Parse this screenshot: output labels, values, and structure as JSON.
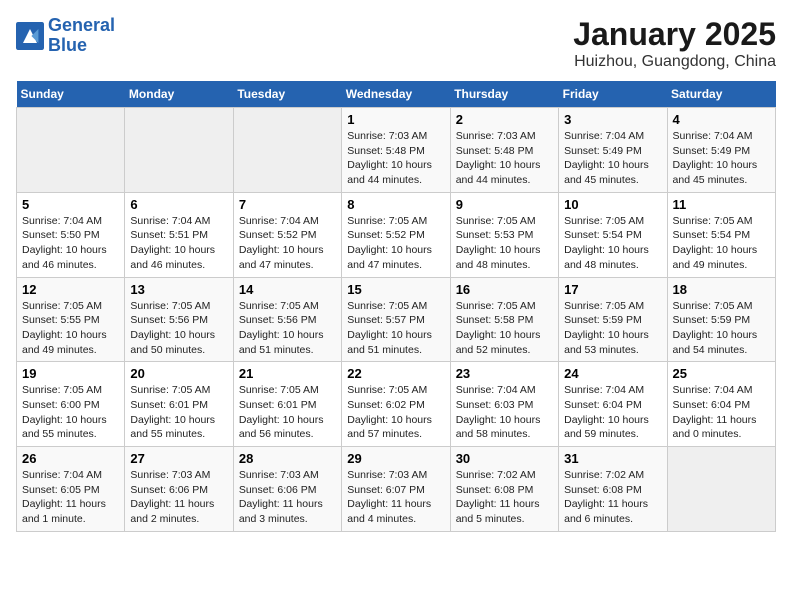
{
  "logo": {
    "line1": "General",
    "line2": "Blue"
  },
  "title": "January 2025",
  "subtitle": "Huizhou, Guangdong, China",
  "weekdays": [
    "Sunday",
    "Monday",
    "Tuesday",
    "Wednesday",
    "Thursday",
    "Friday",
    "Saturday"
  ],
  "weeks": [
    [
      {
        "day": "",
        "sunrise": "",
        "sunset": "",
        "daylight": "",
        "empty": true
      },
      {
        "day": "",
        "sunrise": "",
        "sunset": "",
        "daylight": "",
        "empty": true
      },
      {
        "day": "",
        "sunrise": "",
        "sunset": "",
        "daylight": "",
        "empty": true
      },
      {
        "day": "1",
        "sunrise": "Sunrise: 7:03 AM",
        "sunset": "Sunset: 5:48 PM",
        "daylight": "Daylight: 10 hours and 44 minutes."
      },
      {
        "day": "2",
        "sunrise": "Sunrise: 7:03 AM",
        "sunset": "Sunset: 5:48 PM",
        "daylight": "Daylight: 10 hours and 44 minutes."
      },
      {
        "day": "3",
        "sunrise": "Sunrise: 7:04 AM",
        "sunset": "Sunset: 5:49 PM",
        "daylight": "Daylight: 10 hours and 45 minutes."
      },
      {
        "day": "4",
        "sunrise": "Sunrise: 7:04 AM",
        "sunset": "Sunset: 5:49 PM",
        "daylight": "Daylight: 10 hours and 45 minutes."
      }
    ],
    [
      {
        "day": "5",
        "sunrise": "Sunrise: 7:04 AM",
        "sunset": "Sunset: 5:50 PM",
        "daylight": "Daylight: 10 hours and 46 minutes."
      },
      {
        "day": "6",
        "sunrise": "Sunrise: 7:04 AM",
        "sunset": "Sunset: 5:51 PM",
        "daylight": "Daylight: 10 hours and 46 minutes."
      },
      {
        "day": "7",
        "sunrise": "Sunrise: 7:04 AM",
        "sunset": "Sunset: 5:52 PM",
        "daylight": "Daylight: 10 hours and 47 minutes."
      },
      {
        "day": "8",
        "sunrise": "Sunrise: 7:05 AM",
        "sunset": "Sunset: 5:52 PM",
        "daylight": "Daylight: 10 hours and 47 minutes."
      },
      {
        "day": "9",
        "sunrise": "Sunrise: 7:05 AM",
        "sunset": "Sunset: 5:53 PM",
        "daylight": "Daylight: 10 hours and 48 minutes."
      },
      {
        "day": "10",
        "sunrise": "Sunrise: 7:05 AM",
        "sunset": "Sunset: 5:54 PM",
        "daylight": "Daylight: 10 hours and 48 minutes."
      },
      {
        "day": "11",
        "sunrise": "Sunrise: 7:05 AM",
        "sunset": "Sunset: 5:54 PM",
        "daylight": "Daylight: 10 hours and 49 minutes."
      }
    ],
    [
      {
        "day": "12",
        "sunrise": "Sunrise: 7:05 AM",
        "sunset": "Sunset: 5:55 PM",
        "daylight": "Daylight: 10 hours and 49 minutes."
      },
      {
        "day": "13",
        "sunrise": "Sunrise: 7:05 AM",
        "sunset": "Sunset: 5:56 PM",
        "daylight": "Daylight: 10 hours and 50 minutes."
      },
      {
        "day": "14",
        "sunrise": "Sunrise: 7:05 AM",
        "sunset": "Sunset: 5:56 PM",
        "daylight": "Daylight: 10 hours and 51 minutes."
      },
      {
        "day": "15",
        "sunrise": "Sunrise: 7:05 AM",
        "sunset": "Sunset: 5:57 PM",
        "daylight": "Daylight: 10 hours and 51 minutes."
      },
      {
        "day": "16",
        "sunrise": "Sunrise: 7:05 AM",
        "sunset": "Sunset: 5:58 PM",
        "daylight": "Daylight: 10 hours and 52 minutes."
      },
      {
        "day": "17",
        "sunrise": "Sunrise: 7:05 AM",
        "sunset": "Sunset: 5:59 PM",
        "daylight": "Daylight: 10 hours and 53 minutes."
      },
      {
        "day": "18",
        "sunrise": "Sunrise: 7:05 AM",
        "sunset": "Sunset: 5:59 PM",
        "daylight": "Daylight: 10 hours and 54 minutes."
      }
    ],
    [
      {
        "day": "19",
        "sunrise": "Sunrise: 7:05 AM",
        "sunset": "Sunset: 6:00 PM",
        "daylight": "Daylight: 10 hours and 55 minutes."
      },
      {
        "day": "20",
        "sunrise": "Sunrise: 7:05 AM",
        "sunset": "Sunset: 6:01 PM",
        "daylight": "Daylight: 10 hours and 55 minutes."
      },
      {
        "day": "21",
        "sunrise": "Sunrise: 7:05 AM",
        "sunset": "Sunset: 6:01 PM",
        "daylight": "Daylight: 10 hours and 56 minutes."
      },
      {
        "day": "22",
        "sunrise": "Sunrise: 7:05 AM",
        "sunset": "Sunset: 6:02 PM",
        "daylight": "Daylight: 10 hours and 57 minutes."
      },
      {
        "day": "23",
        "sunrise": "Sunrise: 7:04 AM",
        "sunset": "Sunset: 6:03 PM",
        "daylight": "Daylight: 10 hours and 58 minutes."
      },
      {
        "day": "24",
        "sunrise": "Sunrise: 7:04 AM",
        "sunset": "Sunset: 6:04 PM",
        "daylight": "Daylight: 10 hours and 59 minutes."
      },
      {
        "day": "25",
        "sunrise": "Sunrise: 7:04 AM",
        "sunset": "Sunset: 6:04 PM",
        "daylight": "Daylight: 11 hours and 0 minutes."
      }
    ],
    [
      {
        "day": "26",
        "sunrise": "Sunrise: 7:04 AM",
        "sunset": "Sunset: 6:05 PM",
        "daylight": "Daylight: 11 hours and 1 minute."
      },
      {
        "day": "27",
        "sunrise": "Sunrise: 7:03 AM",
        "sunset": "Sunset: 6:06 PM",
        "daylight": "Daylight: 11 hours and 2 minutes."
      },
      {
        "day": "28",
        "sunrise": "Sunrise: 7:03 AM",
        "sunset": "Sunset: 6:06 PM",
        "daylight": "Daylight: 11 hours and 3 minutes."
      },
      {
        "day": "29",
        "sunrise": "Sunrise: 7:03 AM",
        "sunset": "Sunset: 6:07 PM",
        "daylight": "Daylight: 11 hours and 4 minutes."
      },
      {
        "day": "30",
        "sunrise": "Sunrise: 7:02 AM",
        "sunset": "Sunset: 6:08 PM",
        "daylight": "Daylight: 11 hours and 5 minutes."
      },
      {
        "day": "31",
        "sunrise": "Sunrise: 7:02 AM",
        "sunset": "Sunset: 6:08 PM",
        "daylight": "Daylight: 11 hours and 6 minutes."
      },
      {
        "day": "",
        "sunrise": "",
        "sunset": "",
        "daylight": "",
        "empty": true
      }
    ]
  ]
}
